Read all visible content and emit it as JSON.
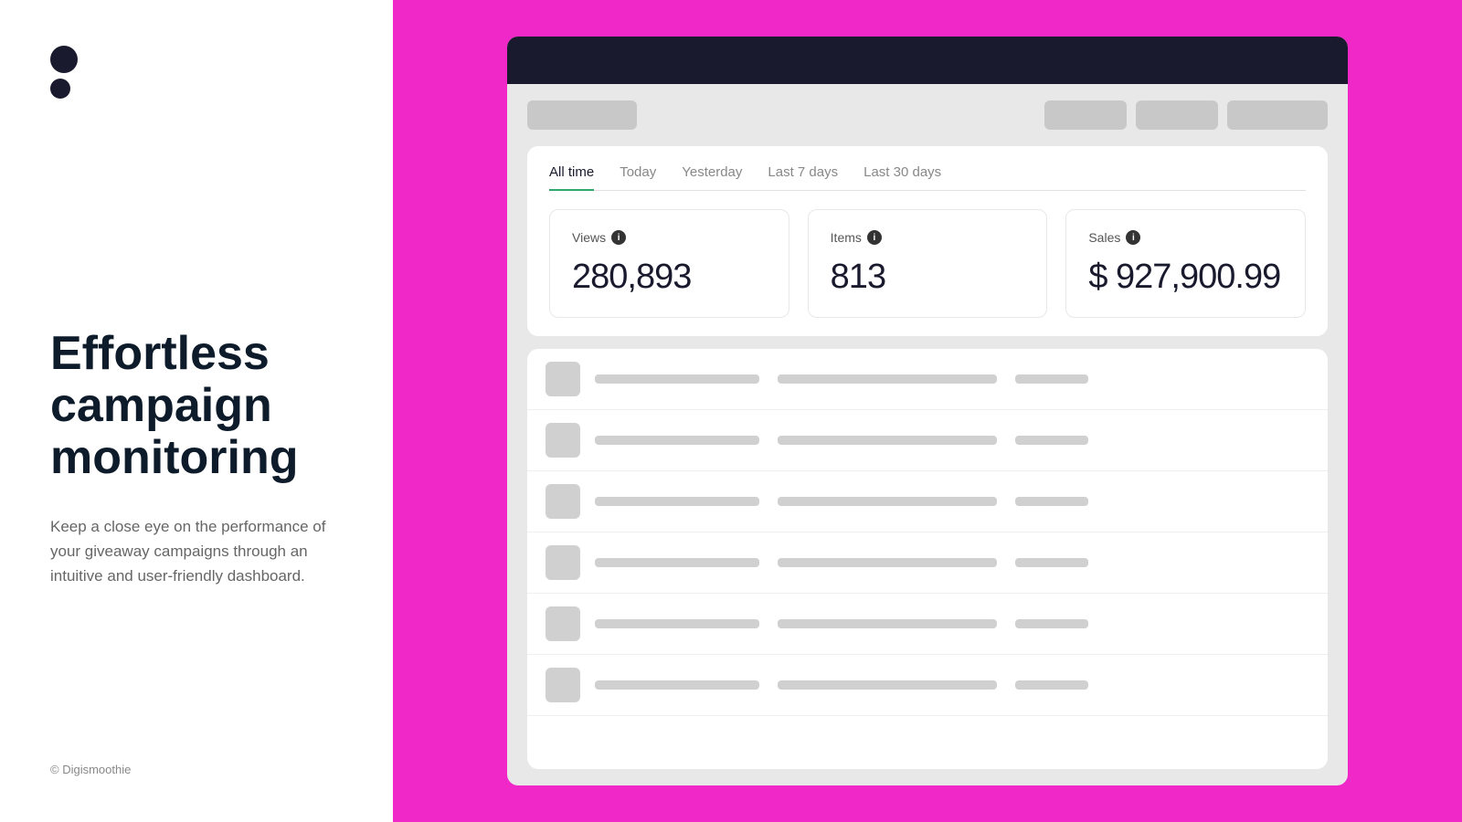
{
  "left": {
    "logo": {
      "dot1_label": "logo-dot-large",
      "dot2_label": "logo-dot-small"
    },
    "heading": "Effortless campaign monitoring",
    "subtext": "Keep a close eye on the performance of your giveaway campaigns through an intuitive and user-friendly dashboard.",
    "copyright": "© Digismoothie"
  },
  "dashboard": {
    "topbar_color": "#1a1a2e",
    "header": {
      "left_btn_label": "",
      "right_btns": [
        "",
        "",
        ""
      ]
    },
    "tabs": [
      {
        "label": "All time",
        "active": true
      },
      {
        "label": "Today",
        "active": false
      },
      {
        "label": "Yesterday",
        "active": false
      },
      {
        "label": "Last 7 days",
        "active": false
      },
      {
        "label": "Last 30 days",
        "active": false
      }
    ],
    "metrics": [
      {
        "label": "Views",
        "value": "280,893"
      },
      {
        "label": "Items",
        "value": "813"
      },
      {
        "label": "Sales",
        "value": "$ 927,900.99"
      }
    ],
    "table_rows": [
      1,
      2,
      3,
      4,
      5,
      6
    ]
  },
  "colors": {
    "accent_green": "#2daa6b",
    "bg_pink": "#f028c8",
    "dark_navy": "#1a1a2e"
  }
}
